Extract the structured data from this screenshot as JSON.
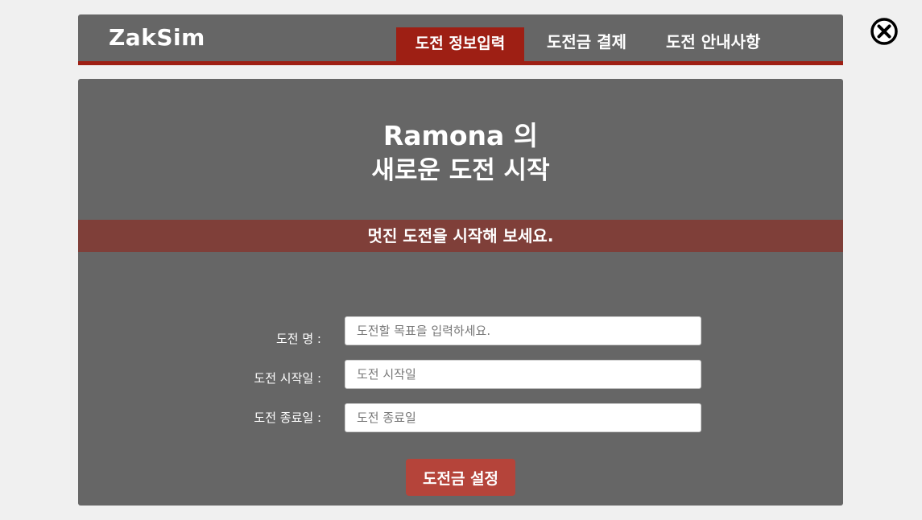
{
  "header": {
    "logo": "ZakSim",
    "tabs": [
      {
        "label": "도전 정보입력",
        "active": true
      },
      {
        "label": "도전금 결제",
        "active": false
      },
      {
        "label": "도전 안내사항",
        "active": false
      }
    ],
    "close_icon": "close-circle-x"
  },
  "main": {
    "title_line1": "Ramona 의",
    "title_line2": "새로운 도전 시작",
    "banner": "멋진 도전을 시작해 보세요.",
    "form": {
      "fields": [
        {
          "label": "도전 명 :",
          "placeholder": "도전할 목표을 입력하세요.",
          "value": ""
        },
        {
          "label": "도전 시작일 :",
          "placeholder": "도전 시작일",
          "value": ""
        },
        {
          "label": "도전 종료일 :",
          "placeholder": "도전 종료일",
          "value": ""
        }
      ],
      "submit_label": "도전금 설정"
    }
  },
  "colors": {
    "accent": "#9e1f14",
    "banner": "#7f3f39",
    "button": "#b5443a",
    "panel": "#666666",
    "page_bg": "#f0f0f0"
  }
}
